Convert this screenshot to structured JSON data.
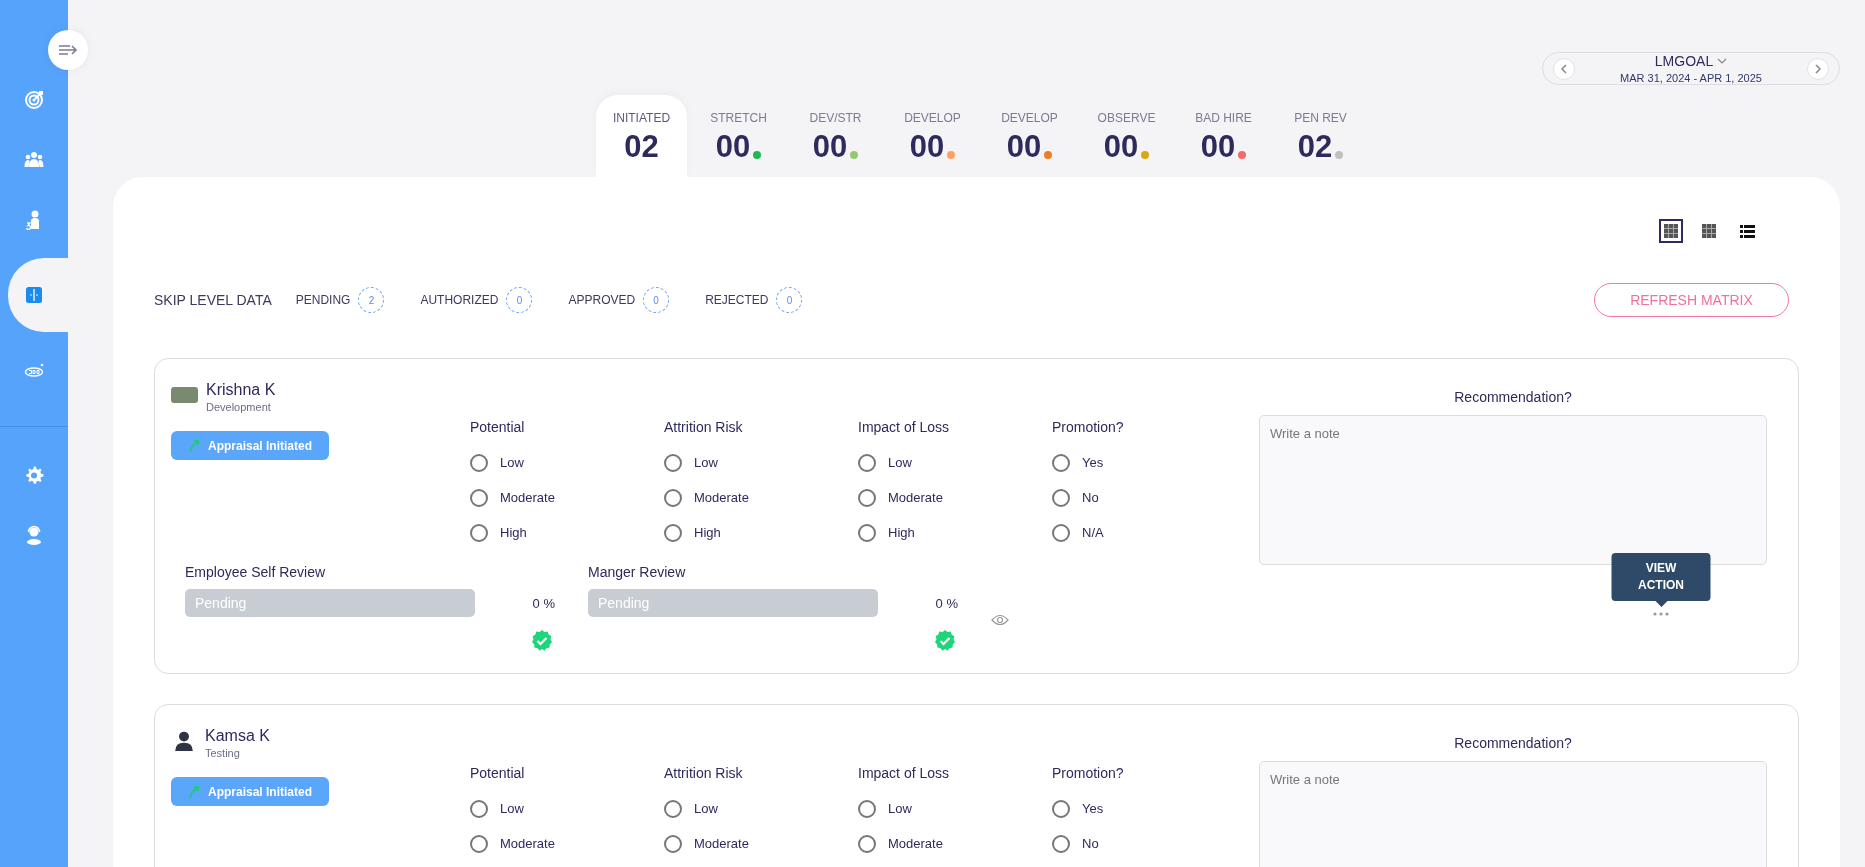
{
  "sidebar": {
    "items": [
      {
        "selected": false
      },
      {
        "selected": false
      },
      {
        "selected": false
      },
      {
        "selected": true
      },
      {
        "selected": false
      }
    ],
    "bottom_items": [
      {
        "selected": false
      },
      {
        "selected": false
      }
    ]
  },
  "period": {
    "title": "LMGOAL",
    "range": "MAR 31, 2024 - APR 1, 2025"
  },
  "tabs": [
    {
      "label": "INITIATED",
      "count": "02",
      "selected": true
    },
    {
      "label": "STRETCH",
      "count": "00",
      "selected": false,
      "color": "#1db954"
    },
    {
      "label": "DEV/STR",
      "count": "00",
      "selected": false,
      "color": "#95c96e"
    },
    {
      "label": "DEVELOP",
      "count": "00",
      "selected": false,
      "color": "#ffa060"
    },
    {
      "label": "DEVELOP",
      "count": "00",
      "selected": false,
      "color": "#f47c20"
    },
    {
      "label": "OBSERVE",
      "count": "00",
      "selected": false,
      "color": "#dba514"
    },
    {
      "label": "BAD HIRE",
      "count": "00",
      "selected": false,
      "color": "#f26a6a"
    },
    {
      "label": "PEN REV",
      "count": "02",
      "selected": false,
      "color": "#c0c0c0"
    }
  ],
  "view_modes": [
    {
      "selected": true
    },
    {
      "selected": false
    },
    {
      "selected": false
    }
  ],
  "skip_level": {
    "title": "SKIP LEVEL DATA",
    "items": [
      {
        "label": "PENDING",
        "count": "2"
      },
      {
        "label": "AUTHORIZED",
        "count": "0"
      },
      {
        "label": "APPROVED",
        "count": "0"
      },
      {
        "label": "REJECTED",
        "count": "0"
      }
    ]
  },
  "refresh_button": "REFRESH MATRIX",
  "cards": [
    {
      "name": "Krishna K",
      "department": "Development",
      "avatar": {
        "kind": "photo"
      },
      "status": "Appraisal Initiated",
      "groups": [
        {
          "title": "Potential",
          "options": [
            {
              "label": "Low",
              "selected": false
            },
            {
              "label": "Moderate",
              "selected": false
            },
            {
              "label": "High",
              "selected": false
            }
          ]
        },
        {
          "title": "Attrition Risk",
          "options": [
            {
              "label": "Low",
              "selected": false
            },
            {
              "label": "Moderate",
              "selected": false
            },
            {
              "label": "High",
              "selected": false
            }
          ]
        },
        {
          "title": "Impact of Loss",
          "options": [
            {
              "label": "Low",
              "selected": false
            },
            {
              "label": "Moderate",
              "selected": false
            },
            {
              "label": "High",
              "selected": false
            }
          ]
        },
        {
          "title": "Promotion?",
          "options": [
            {
              "label": "Yes",
              "selected": false
            },
            {
              "label": "No",
              "selected": false
            },
            {
              "label": "N/A",
              "selected": false
            }
          ]
        }
      ],
      "reviews": [
        {
          "title": "Employee Self Review",
          "status": "Pending",
          "level": 0,
          "percent": "0 %"
        },
        {
          "title": "Manger Review",
          "status": "Pending",
          "level": 0,
          "percent": "0 %"
        }
      ],
      "recommendation": {
        "title": "Recommendation?",
        "placeholder": "Write a note"
      },
      "action_tooltip": "VIEW ACTION"
    },
    {
      "name": "Kamsa K",
      "department": "Testing",
      "avatar": {
        "kind": "silhouette"
      },
      "status": "Appraisal Initiated",
      "groups": [
        {
          "title": "Potential",
          "options": [
            {
              "label": "Low",
              "selected": false
            },
            {
              "label": "Moderate",
              "selected": false
            }
          ]
        },
        {
          "title": "Attrition Risk",
          "options": [
            {
              "label": "Low",
              "selected": false
            },
            {
              "label": "Moderate",
              "selected": false
            }
          ]
        },
        {
          "title": "Impact of Loss",
          "options": [
            {
              "label": "Low",
              "selected": false
            },
            {
              "label": "Moderate",
              "selected": false
            }
          ]
        },
        {
          "title": "Promotion?",
          "options": [
            {
              "label": "Yes",
              "selected": false
            },
            {
              "label": "No",
              "selected": false
            }
          ]
        }
      ],
      "recommendation": {
        "title": "Recommendation?",
        "placeholder": "Write a note"
      }
    }
  ]
}
